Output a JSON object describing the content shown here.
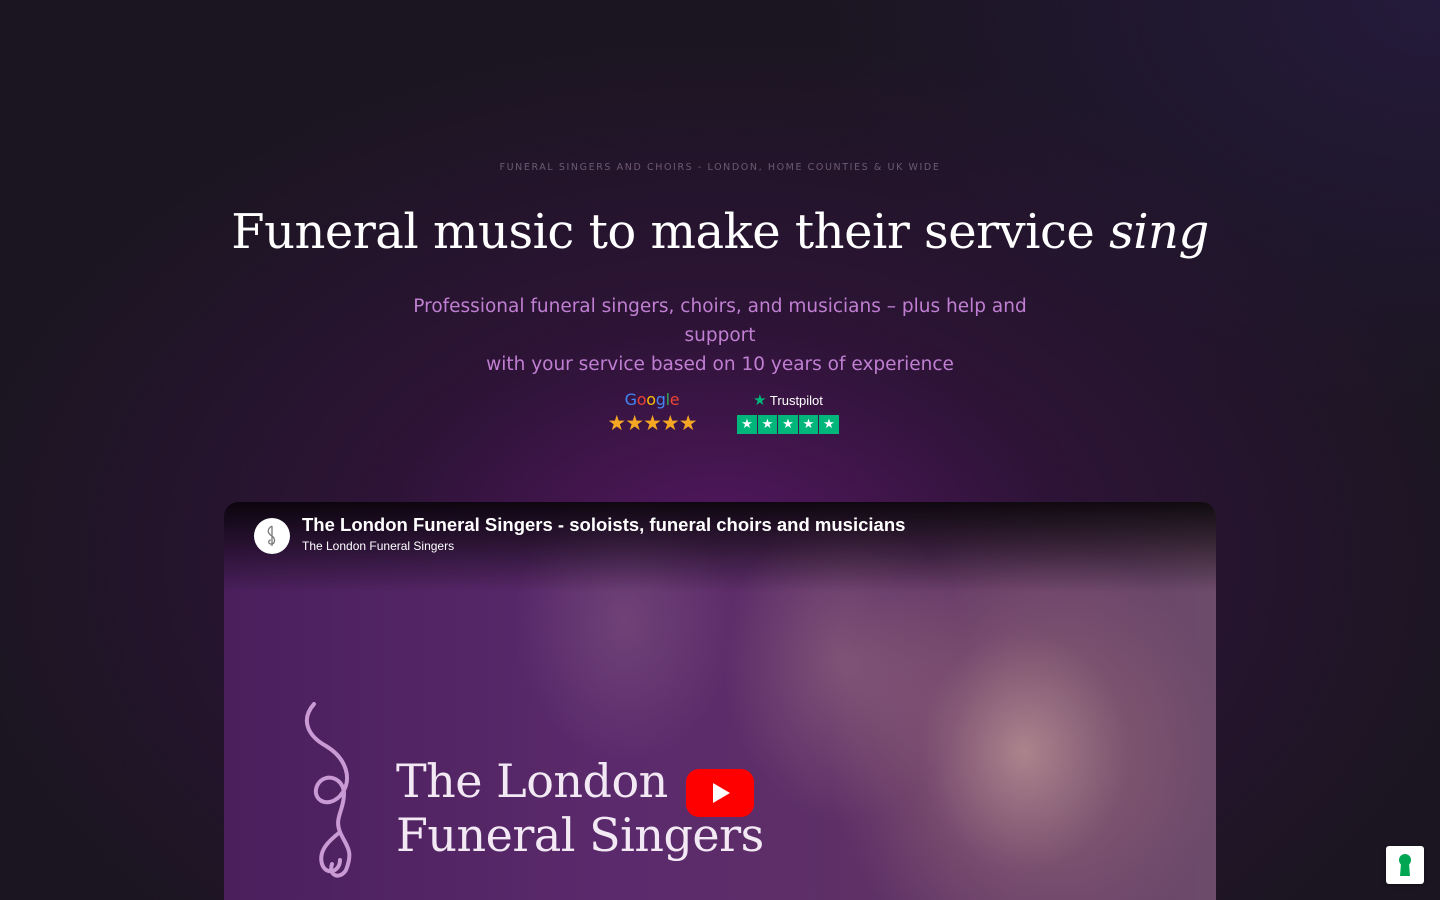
{
  "hero": {
    "eyebrow": "FUNERAL SINGERS AND CHOIRS - LONDON, HOME COUNTIES & UK WIDE",
    "headline_main": "Funeral music to make their service ",
    "headline_emphasis": "sing",
    "subhead_line1": "Professional funeral singers, choirs, and musicians – plus help and support",
    "subhead_line2": "with your service based on 10 years of experience"
  },
  "ratings": {
    "google": {
      "label_letters": [
        "G",
        "o",
        "o",
        "g",
        "l",
        "e"
      ],
      "label_colors": [
        "#4285F4",
        "#EA4335",
        "#FBBC05",
        "#4285F4",
        "#34A853",
        "#EA4335"
      ],
      "stars": "★★★★★",
      "star_rating": 5,
      "star_color": "#f5a623"
    },
    "trustpilot": {
      "label": "Trustpilot",
      "logo_star": "★",
      "star_rating": 5,
      "box_star": "★",
      "color": "#00b67a"
    }
  },
  "video": {
    "title": "The London Funeral Singers - soloists, funeral choirs and musicians",
    "channel": "The London Funeral Singers",
    "brand_line1": "The London",
    "brand_line2": "Funeral Singers",
    "play_icon": "play-icon",
    "play_color": "#ff0000"
  },
  "cookie_badge": {
    "icon": "keyhole-icon",
    "color": "#00a651"
  }
}
